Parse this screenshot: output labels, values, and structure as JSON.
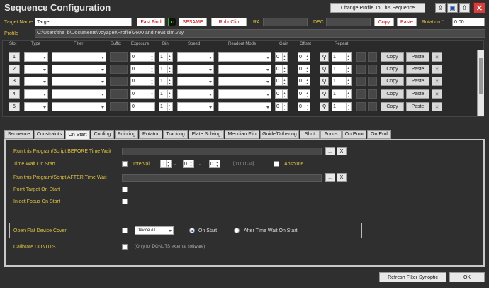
{
  "window": {
    "title": "Sequence Configuration",
    "change_profile_label": "Change Profile To This Sequence"
  },
  "target": {
    "label": "Target Name",
    "value": "Target",
    "fast_find": "Fast Find",
    "sesame": "SESAME",
    "roboclip": "RoboClip",
    "ra_label": "RA",
    "dec_label": "DEC",
    "copy": "Copy",
    "paste": "Paste",
    "rotation_label": "Rotation °",
    "rotation_value": "0.00"
  },
  "profile": {
    "label": "Profile",
    "value": "C:\\Users\\the_b\\Documents\\Voyager\\Profile\\2600 and newt sim.v2y"
  },
  "grid": {
    "headers": [
      "Slot",
      "Type",
      "Filter",
      "Suffix",
      "Exposure",
      "Bin",
      "Speed",
      "Readout Mode",
      "Gain",
      "Offset",
      "Repeat"
    ],
    "rows": [
      {
        "slot": "1",
        "exposure": "0",
        "bin": "1",
        "gain": "0",
        "offset": "0",
        "repeat": "1",
        "copy": "Copy",
        "paste": "Paste"
      },
      {
        "slot": "2",
        "exposure": "0",
        "bin": "1",
        "gain": "0",
        "offset": "0",
        "repeat": "1",
        "copy": "Copy",
        "paste": "Paste"
      },
      {
        "slot": "3",
        "exposure": "0",
        "bin": "1",
        "gain": "0",
        "offset": "0",
        "repeat": "1",
        "copy": "Copy",
        "paste": "Paste"
      },
      {
        "slot": "4",
        "exposure": "0",
        "bin": "1",
        "gain": "0",
        "offset": "0",
        "repeat": "1",
        "copy": "Copy",
        "paste": "Paste"
      },
      {
        "slot": "5",
        "exposure": "0",
        "bin": "1",
        "gain": "0",
        "offset": "0",
        "repeat": "1",
        "copy": "Copy",
        "paste": "Paste"
      }
    ]
  },
  "tabs": [
    "Sequence",
    "Constraints",
    "On Start",
    "Cooling",
    "Pointing",
    "Rotator",
    "Tracking",
    "Plate Solving",
    "Meridian Flip",
    "Guide/Dithering",
    "Shot",
    "Focus",
    "On Error",
    "On End"
  ],
  "active_tab": "On Start",
  "onstart": {
    "run_before_label": "Run this Program/Script BEFORE Time Wait",
    "time_wait_label": "Time Wait On Start",
    "interval_label": "Interval",
    "interval_h": "0",
    "interval_m": "0",
    "interval_s": "0",
    "time_format": "[hh:mm:ss]",
    "absolute_label": "Absolute",
    "run_after_label": "Run this Program/Script AFTER Time Wait",
    "point_target_label": "Point Target On Start",
    "inject_focus_label": "Inject Focus On Start",
    "flat_cover_label": "Open Flat Device Cover",
    "device_value": "Device #1",
    "on_start_label": "On Start",
    "after_wait_label": "After Time Wait On Start",
    "calibrate_label": "Calibrate DONUTS",
    "calibrate_note": "(Only for DONUTS external software)",
    "browse": "...",
    "clear": "X"
  },
  "footer": {
    "refresh_label": "Refresh Filter Synoptic",
    "ok_label": "OK"
  },
  "colors": {
    "accent_label": "#e0c040",
    "background": "#2f2f2f",
    "radio_selected": "#1a5ec8",
    "close_red": "#d24040"
  }
}
